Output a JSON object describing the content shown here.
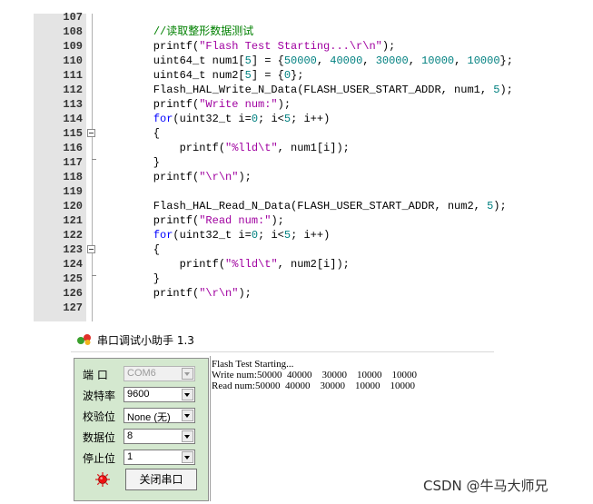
{
  "editor": {
    "lines": [
      {
        "num": "107",
        "tokens": []
      },
      {
        "num": "108",
        "tokens": [
          {
            "t": "    ",
            "c": ""
          },
          {
            "t": "//读取整形数据测试",
            "c": "com"
          }
        ]
      },
      {
        "num": "109",
        "tokens": [
          {
            "t": "    printf(",
            "c": ""
          },
          {
            "t": "\"Flash Test Starting...\\r\\n\"",
            "c": "str"
          },
          {
            "t": ");",
            "c": ""
          }
        ]
      },
      {
        "num": "110",
        "tokens": [
          {
            "t": "    uint64_t num1[",
            "c": ""
          },
          {
            "t": "5",
            "c": "num"
          },
          {
            "t": "] = {",
            "c": ""
          },
          {
            "t": "50000",
            "c": "num"
          },
          {
            "t": ", ",
            "c": ""
          },
          {
            "t": "40000",
            "c": "num"
          },
          {
            "t": ", ",
            "c": ""
          },
          {
            "t": "30000",
            "c": "num"
          },
          {
            "t": ", ",
            "c": ""
          },
          {
            "t": "10000",
            "c": "num"
          },
          {
            "t": ", ",
            "c": ""
          },
          {
            "t": "10000",
            "c": "num"
          },
          {
            "t": "};",
            "c": ""
          }
        ]
      },
      {
        "num": "111",
        "tokens": [
          {
            "t": "    uint64_t num2[",
            "c": ""
          },
          {
            "t": "5",
            "c": "num"
          },
          {
            "t": "] = {",
            "c": ""
          },
          {
            "t": "0",
            "c": "num"
          },
          {
            "t": "};",
            "c": ""
          }
        ]
      },
      {
        "num": "112",
        "tokens": [
          {
            "t": "    Flash_HAL_Write_N_Data(FLASH_USER_START_ADDR, num1, ",
            "c": ""
          },
          {
            "t": "5",
            "c": "num"
          },
          {
            "t": ");",
            "c": ""
          }
        ]
      },
      {
        "num": "113",
        "tokens": [
          {
            "t": "    printf(",
            "c": ""
          },
          {
            "t": "\"Write num:\"",
            "c": "str"
          },
          {
            "t": ");",
            "c": ""
          }
        ]
      },
      {
        "num": "114",
        "tokens": [
          {
            "t": "    ",
            "c": ""
          },
          {
            "t": "for",
            "c": "kw"
          },
          {
            "t": "(uint32_t i=",
            "c": ""
          },
          {
            "t": "0",
            "c": "num"
          },
          {
            "t": "; i<",
            "c": ""
          },
          {
            "t": "5",
            "c": "num"
          },
          {
            "t": "; i++)",
            "c": ""
          }
        ]
      },
      {
        "num": "115",
        "fold": "open",
        "tokens": [
          {
            "t": "    {",
            "c": ""
          }
        ]
      },
      {
        "num": "116",
        "tokens": [
          {
            "t": "        printf(",
            "c": ""
          },
          {
            "t": "\"%lld\\t\"",
            "c": "str"
          },
          {
            "t": ", num1[i]);",
            "c": ""
          }
        ]
      },
      {
        "num": "117",
        "fold": "end",
        "tokens": [
          {
            "t": "    }",
            "c": ""
          }
        ]
      },
      {
        "num": "118",
        "tokens": [
          {
            "t": "    printf(",
            "c": ""
          },
          {
            "t": "\"\\r\\n\"",
            "c": "str"
          },
          {
            "t": ");",
            "c": ""
          }
        ]
      },
      {
        "num": "119",
        "tokens": []
      },
      {
        "num": "120",
        "tokens": [
          {
            "t": "    Flash_HAL_Read_N_Data(FLASH_USER_START_ADDR, num2, ",
            "c": ""
          },
          {
            "t": "5",
            "c": "num"
          },
          {
            "t": ");",
            "c": ""
          }
        ]
      },
      {
        "num": "121",
        "tokens": [
          {
            "t": "    printf(",
            "c": ""
          },
          {
            "t": "\"Read num:\"",
            "c": "str"
          },
          {
            "t": ");",
            "c": ""
          }
        ]
      },
      {
        "num": "122",
        "tokens": [
          {
            "t": "    ",
            "c": ""
          },
          {
            "t": "for",
            "c": "kw"
          },
          {
            "t": "(uint32_t i=",
            "c": ""
          },
          {
            "t": "0",
            "c": "num"
          },
          {
            "t": "; i<",
            "c": ""
          },
          {
            "t": "5",
            "c": "num"
          },
          {
            "t": "; i++)",
            "c": ""
          }
        ]
      },
      {
        "num": "123",
        "fold": "open",
        "tokens": [
          {
            "t": "    {",
            "c": ""
          }
        ]
      },
      {
        "num": "124",
        "tokens": [
          {
            "t": "        printf(",
            "c": ""
          },
          {
            "t": "\"%lld\\t\"",
            "c": "str"
          },
          {
            "t": ", num2[i]);",
            "c": ""
          }
        ]
      },
      {
        "num": "125",
        "fold": "end",
        "tokens": [
          {
            "t": "    }",
            "c": ""
          }
        ]
      },
      {
        "num": "126",
        "tokens": [
          {
            "t": "    printf(",
            "c": ""
          },
          {
            "t": "\"\\r\\n\"",
            "c": "str"
          },
          {
            "t": ");",
            "c": ""
          }
        ]
      },
      {
        "num": "127",
        "tokens": []
      }
    ]
  },
  "serial": {
    "title": "串口调试小助手 1.3",
    "settings": {
      "port_label": "端  口",
      "port_value": "COM6",
      "baud_label": "波特率",
      "baud_value": "9600",
      "parity_label": "校验位",
      "parity_value": "None (无)",
      "databits_label": "数据位",
      "databits_value": "8",
      "stopbits_label": "停止位",
      "stopbits_value": "1"
    },
    "close_port_label": "关闭串口",
    "receive": [
      "Flash Test Starting...",
      "Write num:50000  40000    30000    10000    10000",
      "Read num:50000  40000    30000    10000    10000"
    ]
  },
  "watermark": "CSDN @牛马大师兄",
  "colors": {
    "comment": "#008000",
    "string": "#a000a0",
    "number": "#008080",
    "keyword": "#0000ff",
    "panel": "#d4e8cf",
    "gutter": "#e4e4e4"
  }
}
